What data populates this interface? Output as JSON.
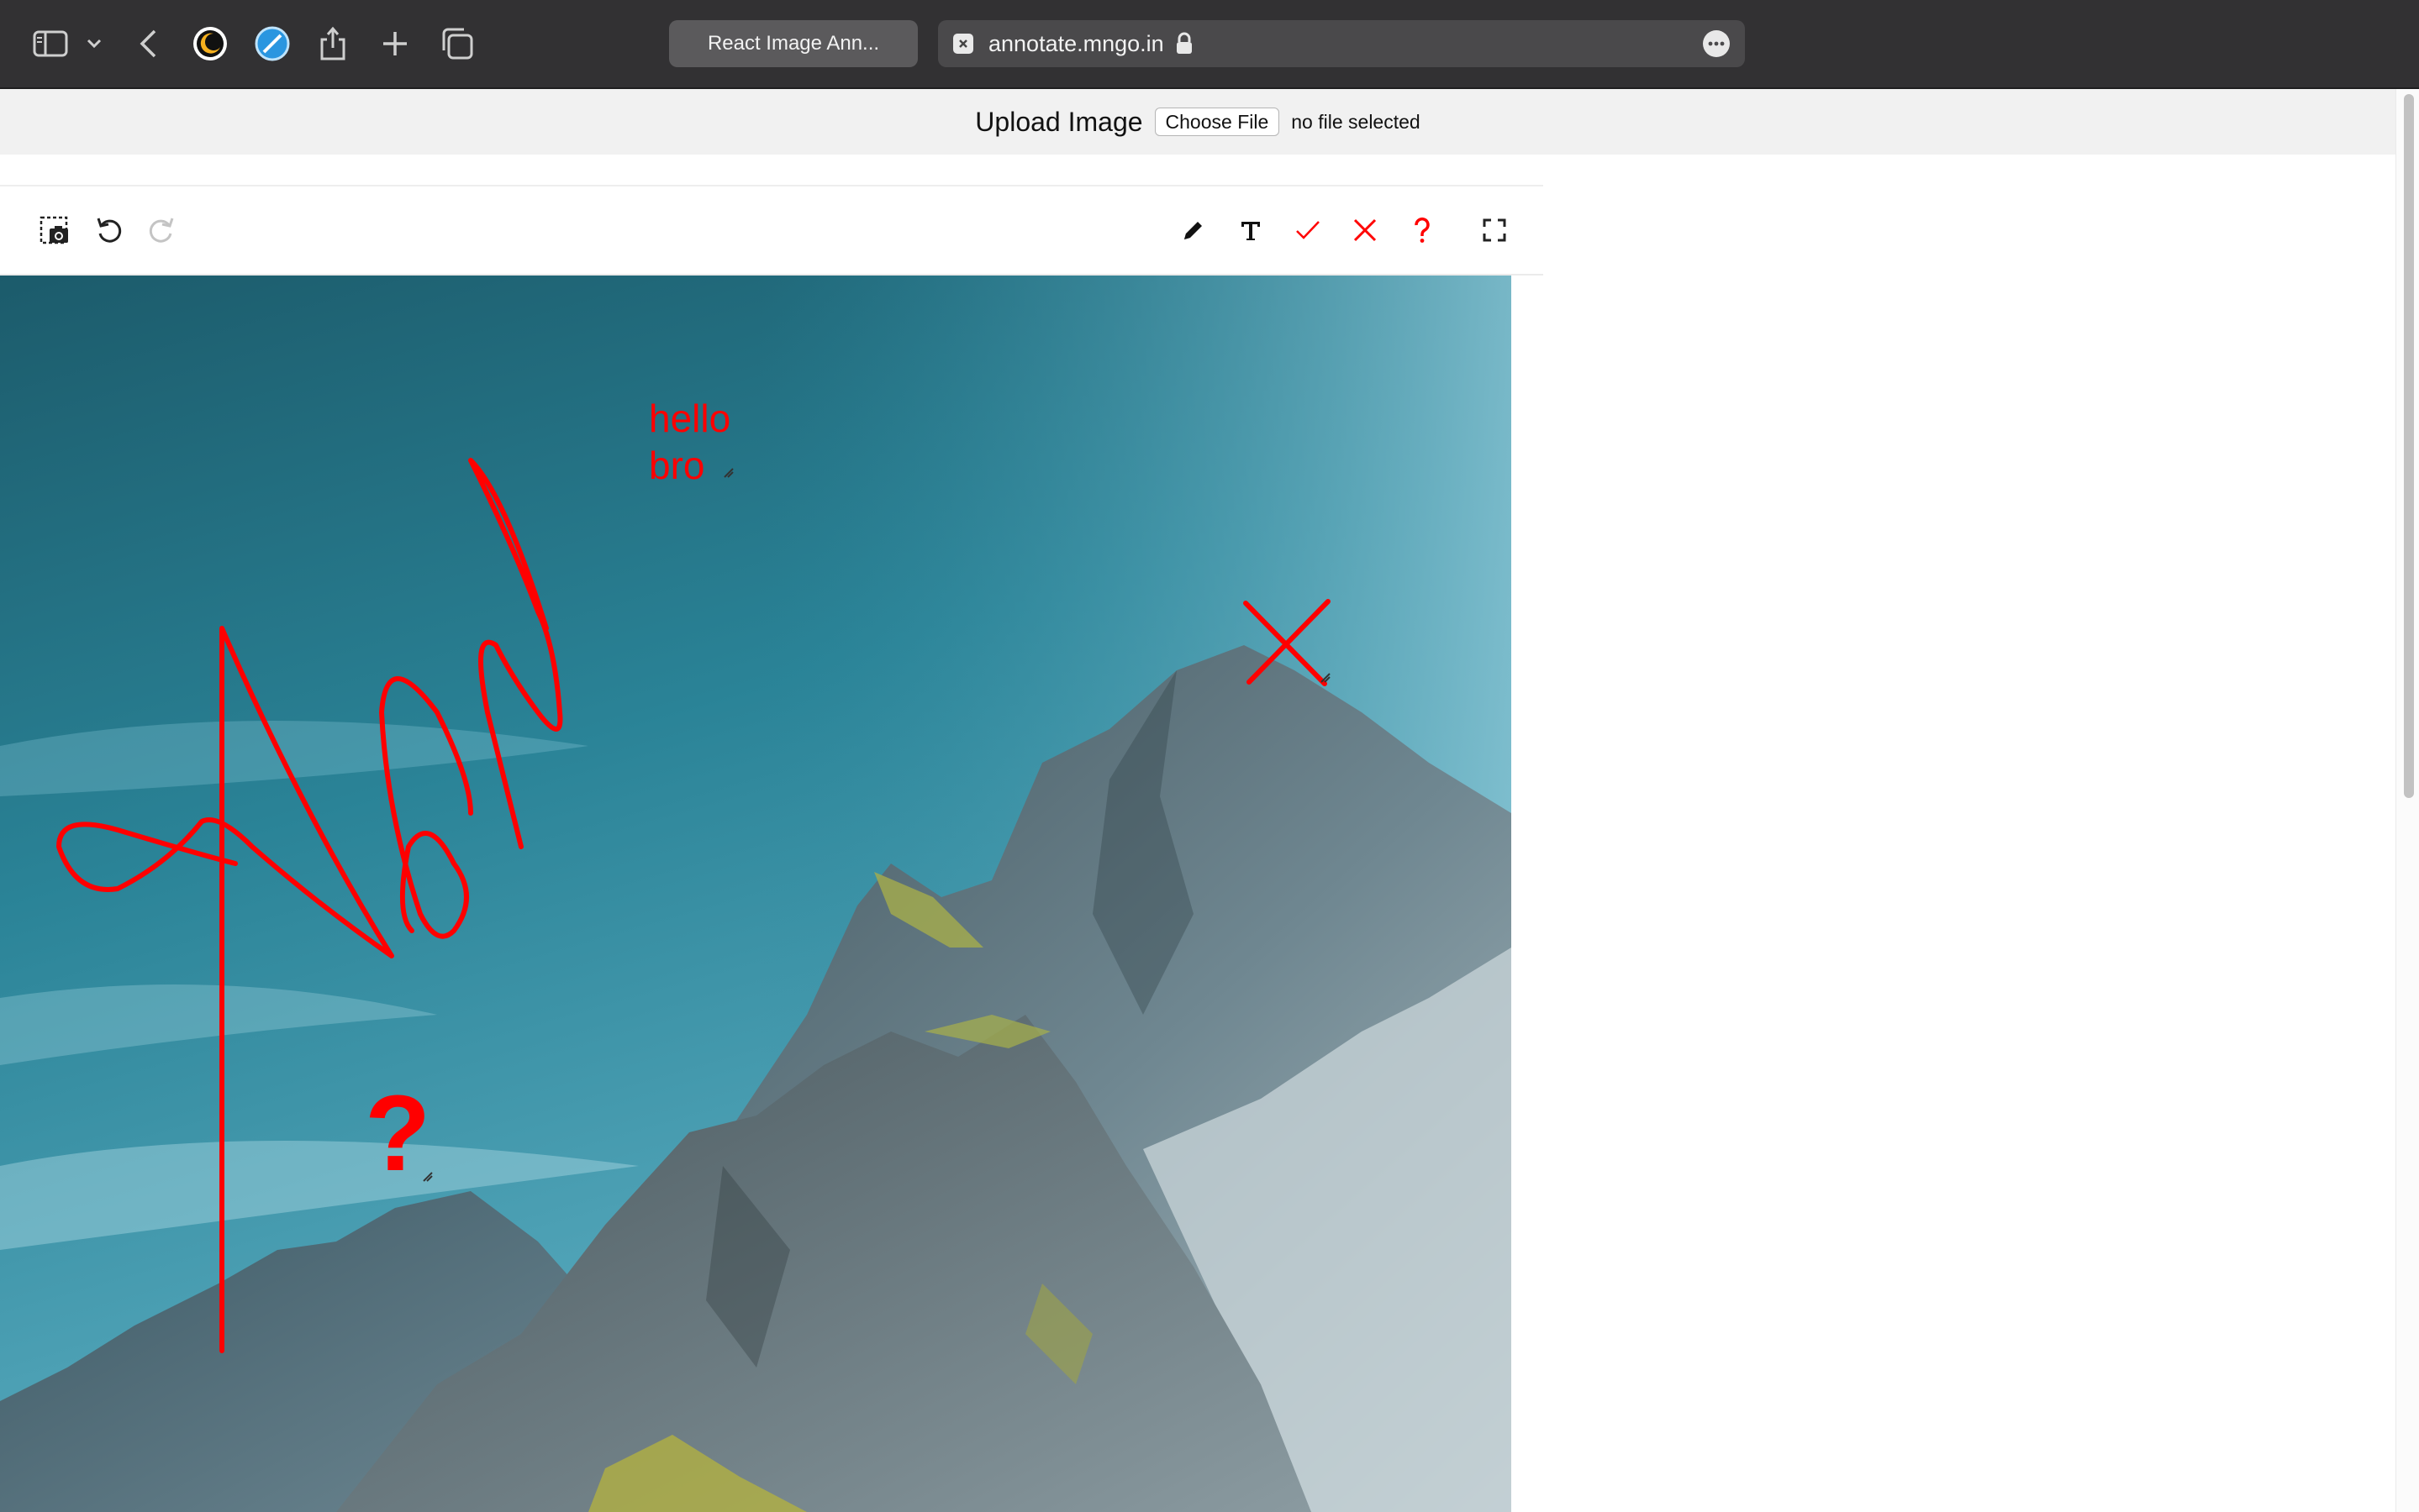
{
  "browser": {
    "tab_title": "React Image Ann...",
    "url": "annotate.mngo.in",
    "icons": [
      "sidebar-icon",
      "chevron-down-icon",
      "back-icon",
      "night-mode-extension-icon",
      "safari-extension-icon",
      "share-icon",
      "new-tab-icon",
      "tab-overview-icon",
      "lock-icon",
      "page-menu-icon"
    ]
  },
  "upload": {
    "label": "Upload Image",
    "button_label": "Choose File",
    "status": "no file selected"
  },
  "toolbar": {
    "left_tools": [
      "screenshot-icon",
      "undo-icon",
      "redo-icon"
    ],
    "right_tools": [
      "pencil-icon",
      "text-icon",
      "check-icon",
      "cross-icon",
      "question-icon",
      "fullscreen-icon"
    ],
    "accent_color": "#ff0000"
  },
  "annotations": {
    "text_note_line1": "hello",
    "text_note_line2": "bro",
    "question_mark": "?",
    "color": "#ff0000"
  }
}
